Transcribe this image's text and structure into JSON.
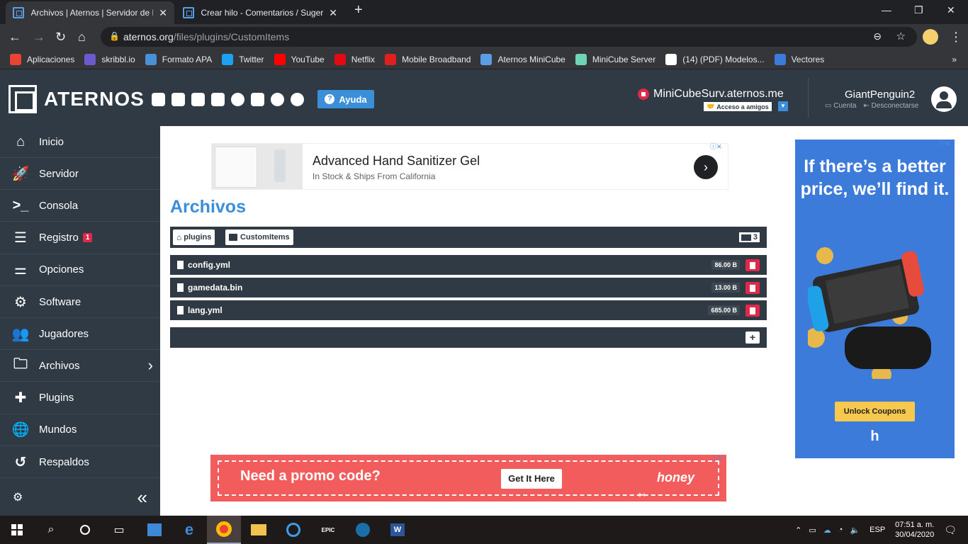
{
  "browser": {
    "tabs": [
      {
        "title": "Archivos | Aternos | Servidor de M",
        "active": true
      },
      {
        "title": "Crear hilo - Comentarios / Sugere",
        "active": false
      }
    ],
    "url_host": "aternos.org",
    "url_path": "/files/plugins/CustomItems",
    "bookmarks": [
      {
        "label": "Aplicaciones",
        "icon": "apps-grid-icon",
        "color": "#ea4335"
      },
      {
        "label": "skribbl.io",
        "icon": "skribbl-icon",
        "color": "#6a5acd"
      },
      {
        "label": "Formato APA",
        "icon": "doc-icon",
        "color": "#4a90d9"
      },
      {
        "label": "Twitter",
        "icon": "twitter-icon",
        "color": "#1da1f2"
      },
      {
        "label": "YouTube",
        "icon": "youtube-icon",
        "color": "#ff0000"
      },
      {
        "label": "Netflix",
        "icon": "netflix-icon",
        "color": "#e50914"
      },
      {
        "label": "Mobile Broadband",
        "icon": "huawei-icon",
        "color": "#e02020"
      },
      {
        "label": "Aternos MiniCube",
        "icon": "aternos-icon",
        "color": "#5a9ee8"
      },
      {
        "label": "MiniCube Server",
        "icon": "sword-icon",
        "color": "#6fd3b8"
      },
      {
        "label": "(14) (PDF) Modelos...",
        "icon": "academia-icon",
        "color": "#ffffff"
      },
      {
        "label": "Vectores",
        "icon": "vector-icon",
        "color": "#3b7bdb"
      }
    ]
  },
  "header": {
    "logo_text": "ATERNOS",
    "help_label": "Ayuda",
    "server_address": "MiniCubeSurv.aternos.me",
    "friends_label": "Acceso a amigos",
    "username": "GiantPenguin2",
    "account_label": "Cuenta",
    "logout_label": "Desconectarse"
  },
  "sidebar": {
    "items": [
      {
        "label": "Inicio",
        "icon": "home-icon"
      },
      {
        "label": "Servidor",
        "icon": "rocket-icon"
      },
      {
        "label": "Consola",
        "icon": "terminal-icon"
      },
      {
        "label": "Registro",
        "icon": "log-icon",
        "badge": "1"
      },
      {
        "label": "Opciones",
        "icon": "sliders-icon"
      },
      {
        "label": "Software",
        "icon": "gears-icon"
      },
      {
        "label": "Jugadores",
        "icon": "users-icon"
      },
      {
        "label": "Archivos",
        "icon": "folder-icon",
        "chevron": "›"
      },
      {
        "label": "Plugins",
        "icon": "puzzle-icon"
      },
      {
        "label": "Mundos",
        "icon": "globe-icon"
      },
      {
        "label": "Respaldos",
        "icon": "history-icon"
      }
    ],
    "collapse_label": "«"
  },
  "main": {
    "title": "Archivos",
    "breadcrumbs": [
      "plugins",
      "CustomItems"
    ],
    "file_count": "3",
    "files": [
      {
        "name": "config.yml",
        "size": "86.00 B"
      },
      {
        "name": "gamedata.bin",
        "size": "13.00 B"
      },
      {
        "name": "lang.yml",
        "size": "685.00 B"
      }
    ],
    "add_label": "+"
  },
  "ads": {
    "top_title": "Advanced Hand Sanitizer Gel",
    "top_subtitle": "In Stock & Ships From California",
    "top_go": "›",
    "side_headline": "If there’s a better price, we’ll find it.",
    "side_cta": "Unlock Coupons",
    "side_logo": "h",
    "bottom_headline": "Need a promo code?",
    "bottom_cta": "Get It Here",
    "bottom_logo": "honey"
  },
  "taskbar": {
    "lang": "ESP",
    "time": "07:51 a. m.",
    "date": "30/04/2020"
  }
}
